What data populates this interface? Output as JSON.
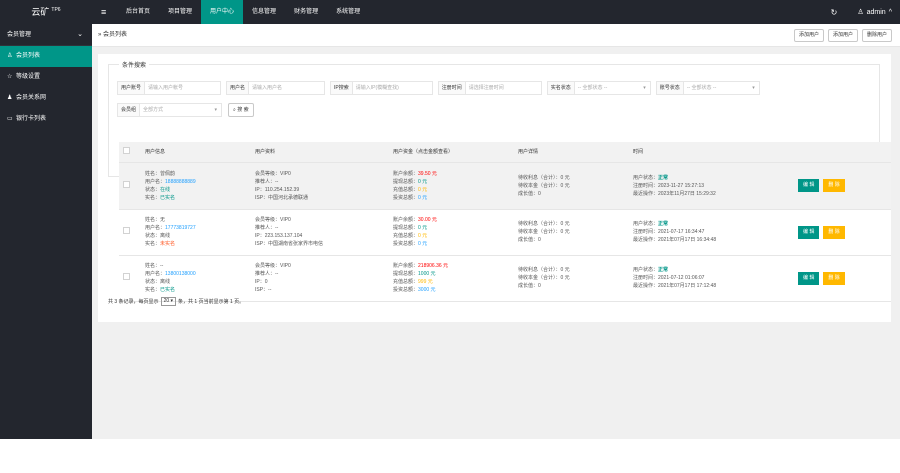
{
  "app": {
    "logo": "云矿",
    "logo_sup": "TP6"
  },
  "topnav": {
    "items": [
      "后台首页",
      "项目管理",
      "用户中心",
      "信息管理",
      "财务管理",
      "系统管理"
    ],
    "active_index": 2,
    "user": "admin"
  },
  "sidebar": {
    "group": "会员管理",
    "items": [
      {
        "label": "会员列表",
        "icon": "user-icon",
        "active": true
      },
      {
        "label": "等级设置",
        "icon": "star-icon",
        "active": false
      },
      {
        "label": "会员关系网",
        "icon": "users-icon",
        "active": false
      },
      {
        "label": "银行卡列表",
        "icon": "card-icon",
        "active": false
      }
    ]
  },
  "breadcrumb": {
    "prefix": "»",
    "label": "会员列表"
  },
  "crumb_buttons": [
    "添加用户",
    "添加用户",
    "删除用户"
  ],
  "filter": {
    "legend": "条件搜索",
    "row1": [
      {
        "label": "用户账号",
        "placeholder": "请输入用户帐号"
      },
      {
        "label": "用户名",
        "placeholder": "请输入用户名"
      },
      {
        "label": "IP搜索",
        "placeholder": "请输入IP(模糊查找)"
      },
      {
        "label": "注册时间",
        "placeholder": "请选择注册时间"
      },
      {
        "label": "实名状态",
        "placeholder": "-- 全部状态 --"
      },
      {
        "label": "账号状态",
        "placeholder": "-- 全部状态 --"
      }
    ],
    "row2": [
      {
        "label": "会员组",
        "placeholder": "全部方式"
      }
    ],
    "search_label": "搜 索"
  },
  "table": {
    "headers": [
      "用户信息",
      "用户资料",
      "用户资金（点击金额查看）",
      "用户详情",
      "时间"
    ],
    "actions": {
      "edit": "编 辑",
      "delete": "删 除"
    },
    "rows": [
      {
        "info": {
          "name": "姓名：曾佩韵",
          "username_label": "用户名：",
          "username": "18888888889",
          "status_label": "状态：",
          "status": "在线",
          "realname_label": "实名：",
          "realname": "已实名"
        },
        "profile": [
          "会员等级：VIP0",
          "推荐人：--",
          "IP：110.254.152.39",
          "ISP：中国河北承德联通"
        ],
        "funds": [
          {
            "label": "账户余额：",
            "value": "39.50 元"
          },
          {
            "label": "提现总额：",
            "value": "0 元"
          },
          {
            "label": "充值总额：",
            "value": "0 元"
          },
          {
            "label": "投资总额：",
            "value": "0 元"
          }
        ],
        "details": [
          "待收利息（合计）：0 元",
          "待收本金（合计）：0 元",
          "成长值：0"
        ],
        "time": {
          "status_label": "用户状态：",
          "status": "正常",
          "reg": "注册时间：2023-11-27 15:27:13",
          "last": "最近操作：2023年11月27日 15:29:32"
        }
      },
      {
        "info": {
          "name": "姓名：无",
          "username_label": "用户名：",
          "username": "17773819727",
          "status_label": "状态：",
          "status": "离线",
          "realname_label": "实名：",
          "realname": "未实名"
        },
        "profile": [
          "会员等级：VIP0",
          "推荐人：--",
          "IP：223.153.137.104",
          "ISP：中国湖南省张家界市电信"
        ],
        "funds": [
          {
            "label": "账户余额：",
            "value": "30.00 元"
          },
          {
            "label": "提现总额：",
            "value": "0 元"
          },
          {
            "label": "充值总额：",
            "value": "0 元"
          },
          {
            "label": "投资总额：",
            "value": "0 元"
          }
        ],
        "details": [
          "待收利息（合计）：0 元",
          "待收本金（合计）：0 元",
          "成长值：0"
        ],
        "time": {
          "status_label": "用户状态：",
          "status": "正常",
          "reg": "注册时间：2021-07-17 16:34:47",
          "last": "最近操作：2021年07月17日 16:34:48"
        }
      },
      {
        "info": {
          "name": "姓名：--",
          "username_label": "用户名：",
          "username": "13800138000",
          "status_label": "状态：",
          "status": "离线",
          "realname_label": "实名：",
          "realname": "已实名"
        },
        "profile": [
          "会员等级：VIP0",
          "推荐人：--",
          "IP：0",
          "ISP：--"
        ],
        "funds": [
          {
            "label": "账户余额：",
            "value": "218906.36 元"
          },
          {
            "label": "提现总额：",
            "value": "1000 元"
          },
          {
            "label": "充值总额：",
            "value": "999 元"
          },
          {
            "label": "投资总额：",
            "value": "3000 元"
          }
        ],
        "details": [
          "待收利息（合计）：0 元",
          "待收本金（合计）：0 元",
          "成长值：0"
        ],
        "time": {
          "status_label": "用户状态：",
          "status": "正常",
          "reg": "注册时间：2021-07-12 01:06:07",
          "last": "最近操作：2021年07月17日 17:12:48"
        }
      }
    ]
  },
  "pager": {
    "prefix": "共 3 条记录，每页显示",
    "per_page": "20",
    "suffix": "条，共 1 页当前显示第 1 页。"
  },
  "colors": {
    "sidebar_bg": "#23262e",
    "accent": "#009688",
    "warn": "#ffb800",
    "link": "#1e9fff"
  }
}
